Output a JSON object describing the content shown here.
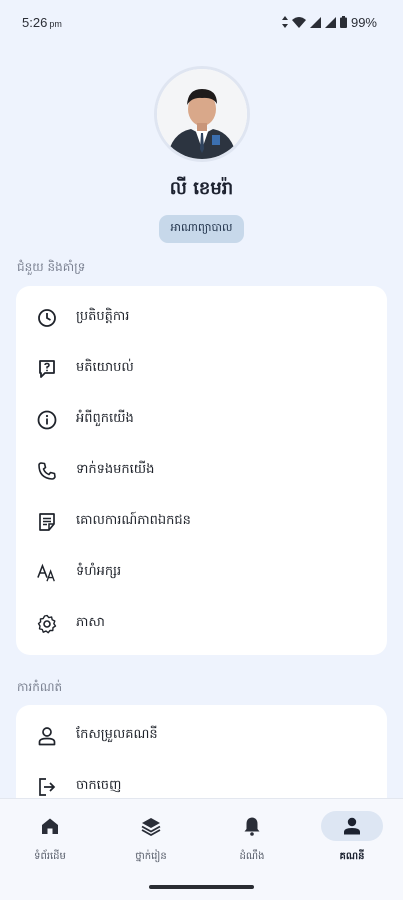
{
  "status": {
    "time": "5:26",
    "ampm": "pm",
    "battery": "99%"
  },
  "profile": {
    "name": "លី ខេមរ៉ា",
    "role": "អាណាព្យាបាល"
  },
  "sections": {
    "support_label": "ជំនួយ និងគាំទ្រ",
    "support_items": [
      {
        "label": "ប្រតិបត្តិការ",
        "icon": "history-icon"
      },
      {
        "label": "មតិយោបល់",
        "icon": "feedback-icon"
      },
      {
        "label": "អំពីពួកយើង",
        "icon": "info-icon"
      },
      {
        "label": "ទាក់ទងមកយើង",
        "icon": "phone-icon"
      },
      {
        "label": "គោលការណ៍ភាពឯកជន",
        "icon": "privacy-note-icon"
      },
      {
        "label": "ទំហំអក្សរ",
        "icon": "text-size-icon"
      },
      {
        "label": "ភាសា",
        "icon": "language-gear-icon"
      }
    ],
    "account_label": "ការកំណត់",
    "account_items": [
      {
        "label": "កែសម្រួលគណនី",
        "icon": "person-icon"
      },
      {
        "label": "ចាកចេញ",
        "icon": "logout-icon"
      }
    ]
  },
  "bottom_nav": [
    {
      "label": "ទំព័រដើម",
      "icon": "home-icon",
      "active": false
    },
    {
      "label": "ថ្នាក់រៀន",
      "icon": "layers-icon",
      "active": false
    },
    {
      "label": "ដំណឹង",
      "icon": "bell-icon",
      "active": false
    },
    {
      "label": "គណនី",
      "icon": "account-icon",
      "active": true
    }
  ]
}
